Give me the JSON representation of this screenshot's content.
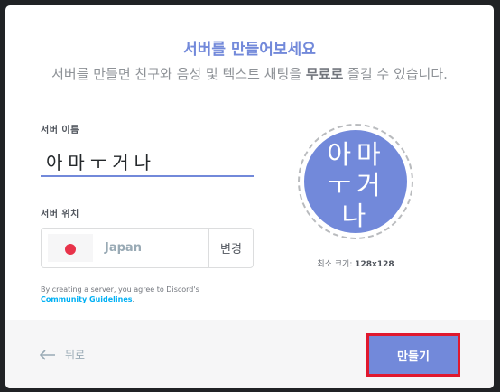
{
  "modal": {
    "title": "서버를 만들어보세요",
    "subtitle_prefix": "서버를 만들면 친구와 음성 및 텍스트 채팅을 ",
    "subtitle_bold": "무료로",
    "subtitle_suffix": " 즐길 수 있습니다."
  },
  "form": {
    "name_label": "서버 이름",
    "name_value": "아마ㅜ거나",
    "region_label": "서버 위치",
    "region_name": "Japan",
    "change_label": "변경",
    "terms_text": "By creating a server, you agree to Discord's",
    "terms_link": "Community Guidelines",
    "terms_period": "."
  },
  "avatar": {
    "text": "아마ㅜ거나",
    "min_size_label": "최소 크기:",
    "min_size_value": "128x128"
  },
  "footer": {
    "back_label": "뒤로",
    "create_label": "만들기"
  },
  "colors": {
    "accent": "#7289da",
    "highlight": "#e0182e",
    "link": "#00b0f4"
  }
}
